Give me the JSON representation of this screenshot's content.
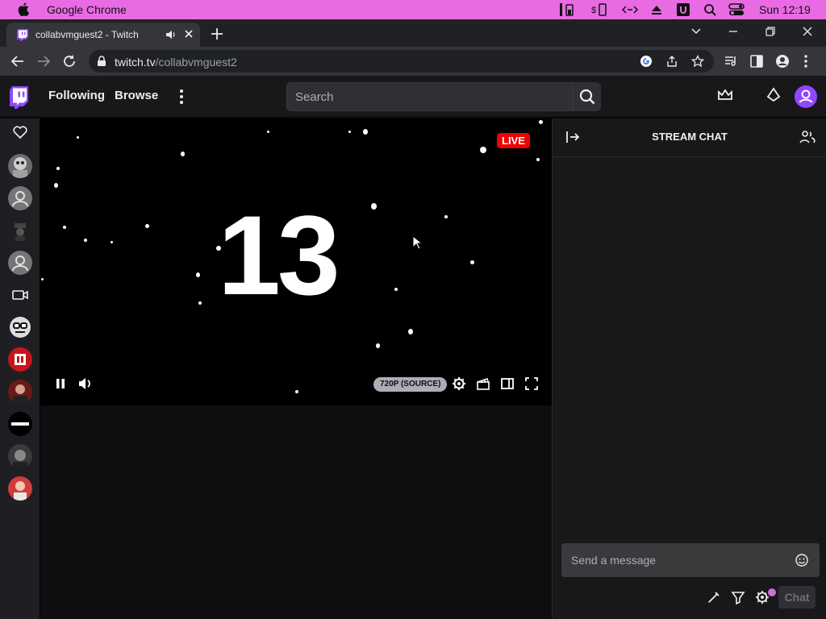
{
  "menubar": {
    "app_name": "Google Chrome",
    "clock": "Sun 12:19"
  },
  "browser": {
    "tab_title": "collabvmguest2 - Twitch",
    "url_host": "twitch.tv",
    "url_path": "/collabvmguest2"
  },
  "twitch": {
    "nav": {
      "following": "Following",
      "browse": "Browse"
    },
    "search": {
      "placeholder": "Search"
    },
    "player": {
      "countdown": "13",
      "live_badge": "LIVE",
      "quality": "720P (SOURCE)"
    },
    "chat": {
      "title": "STREAM CHAT",
      "input_placeholder": "Send a message",
      "chat_button": "Chat"
    },
    "colors": {
      "brand": "#9147ff",
      "live": "#eb0400",
      "background": "#0e0e10",
      "panel": "#18181b"
    }
  }
}
